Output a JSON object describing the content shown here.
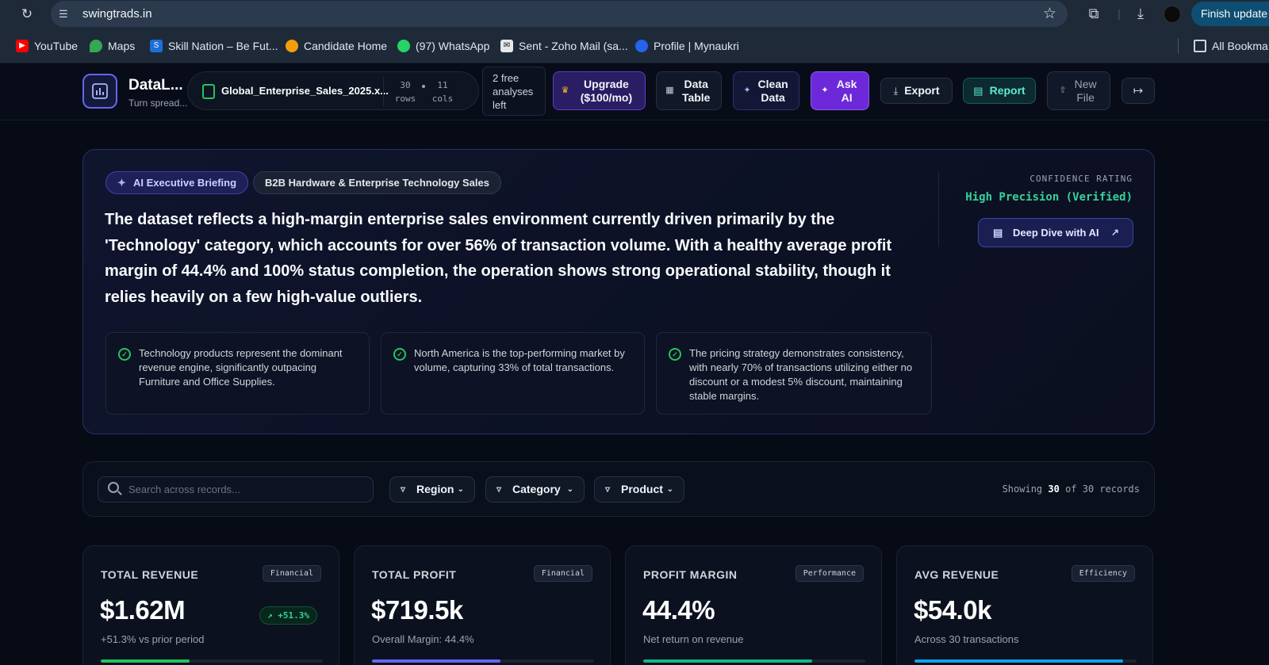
{
  "browser": {
    "url": "swingtrads.in",
    "finish_update": "Finish update",
    "bookmarks": [
      {
        "label": "YouTube",
        "icon": "youtube-icon"
      },
      {
        "label": "Maps",
        "icon": "maps-icon"
      },
      {
        "label": "Skill Nation – Be Fut...",
        "icon": "skill-nation-icon"
      },
      {
        "label": "Candidate Home",
        "icon": "candidate-icon"
      },
      {
        "label": "(97) WhatsApp",
        "icon": "whatsapp-icon"
      },
      {
        "label": "Sent - Zoho Mail (sa...",
        "icon": "zoho-mail-icon"
      },
      {
        "label": "Profile | Mynaukri",
        "icon": "mynaukri-icon"
      }
    ],
    "all_bookmarks": "All Bookma"
  },
  "header": {
    "app_name": "DataL...",
    "app_tagline": "Turn spread...",
    "file_name": "Global_Enterprise_Sales_2025.x...",
    "rows_count": "30",
    "rows_label": "rows",
    "cols_count": "11",
    "cols_label": "cols",
    "free_analyses": "2 free analyses left",
    "buttons": {
      "upgrade": "Upgrade ($100/mo)",
      "data_table": "Data Table",
      "clean_data": "Clean Data",
      "ask_ai": "Ask AI",
      "export": "Export",
      "report": "Report",
      "new_file": "New File"
    }
  },
  "briefing": {
    "badge": "AI Executive Briefing",
    "category": "B2B Hardware & Enterprise Technology Sales",
    "summary": "The dataset reflects a high-margin enterprise sales environment currently driven primarily by the 'Technology' category, which accounts for over 56% of transaction volume. With a healthy average profit margin of 44.4% and 100% status completion, the operation shows strong operational stability, though it relies heavily on a few high-value outliers.",
    "confidence_label": "CONFIDENCE RATING",
    "confidence_value": "High Precision (Verified)",
    "deep_dive": "Deep Dive with AI",
    "insights": [
      "Technology products represent the dominant revenue engine, significantly outpacing Furniture and Office Supplies.",
      "North America is the top-performing market by volume, capturing 33% of total transactions.",
      "The pricing strategy demonstrates consistency, with nearly 70% of transactions utilizing either no discount or a modest 5% discount, maintaining stable margins."
    ]
  },
  "filters": {
    "search_placeholder": "Search across records...",
    "region": "Region",
    "category": "Category",
    "product": "Product",
    "showing_prefix": "Showing",
    "showing_count": "30",
    "showing_suffix": "of 30 records"
  },
  "kpis": [
    {
      "label": "TOTAL REVENUE",
      "badge": "Financial",
      "value": "$1.62M",
      "change": "+51.3%",
      "sub": "+51.3% vs prior period",
      "progress": 0.4,
      "color": "#22c55e"
    },
    {
      "label": "TOTAL PROFIT",
      "badge": "Financial",
      "value": "$719.5k",
      "sub": "Overall Margin: 44.4%",
      "progress": 0.58,
      "color": "#6366f1"
    },
    {
      "label": "PROFIT MARGIN",
      "badge": "Performance",
      "value": "44.4%",
      "sub": "Net return on revenue",
      "progress": 0.76,
      "color": "#10b981"
    },
    {
      "label": "AVG REVENUE",
      "badge": "Efficiency",
      "value": "$54.0k",
      "sub": "Across 30 transactions",
      "progress": 0.94,
      "color": "#0ea5e9"
    }
  ]
}
